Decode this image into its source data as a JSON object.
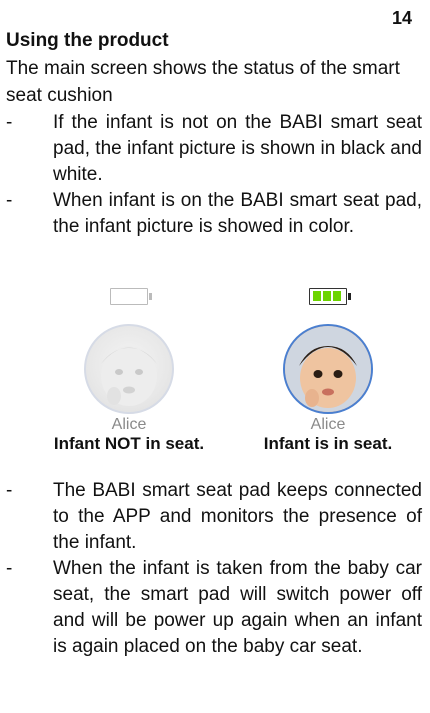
{
  "page_number": "14",
  "heading": "Using the product",
  "intro": "The main screen shows the status of the smart seat cushion",
  "bullets_top": [
    "If the infant is not on the BABI smart seat pad, the infant picture is shown in black and white.",
    "When infant is on the BABI smart seat pad, the infant picture is showed in color."
  ],
  "figure": {
    "left": {
      "name": "Alice",
      "caption": "Infant NOT in seat.",
      "battery_level": 0
    },
    "right": {
      "name": "Alice",
      "caption": "Infant is in seat.",
      "battery_level": 1.0
    }
  },
  "bullets_bottom": [
    "The BABI smart seat pad keeps connected to the APP and monitors the presence of the infant.",
    "When the infant is taken from the baby car seat, the smart pad will switch power off and will be power up again when an infant is again placed on the baby car seat."
  ],
  "dash": "-"
}
